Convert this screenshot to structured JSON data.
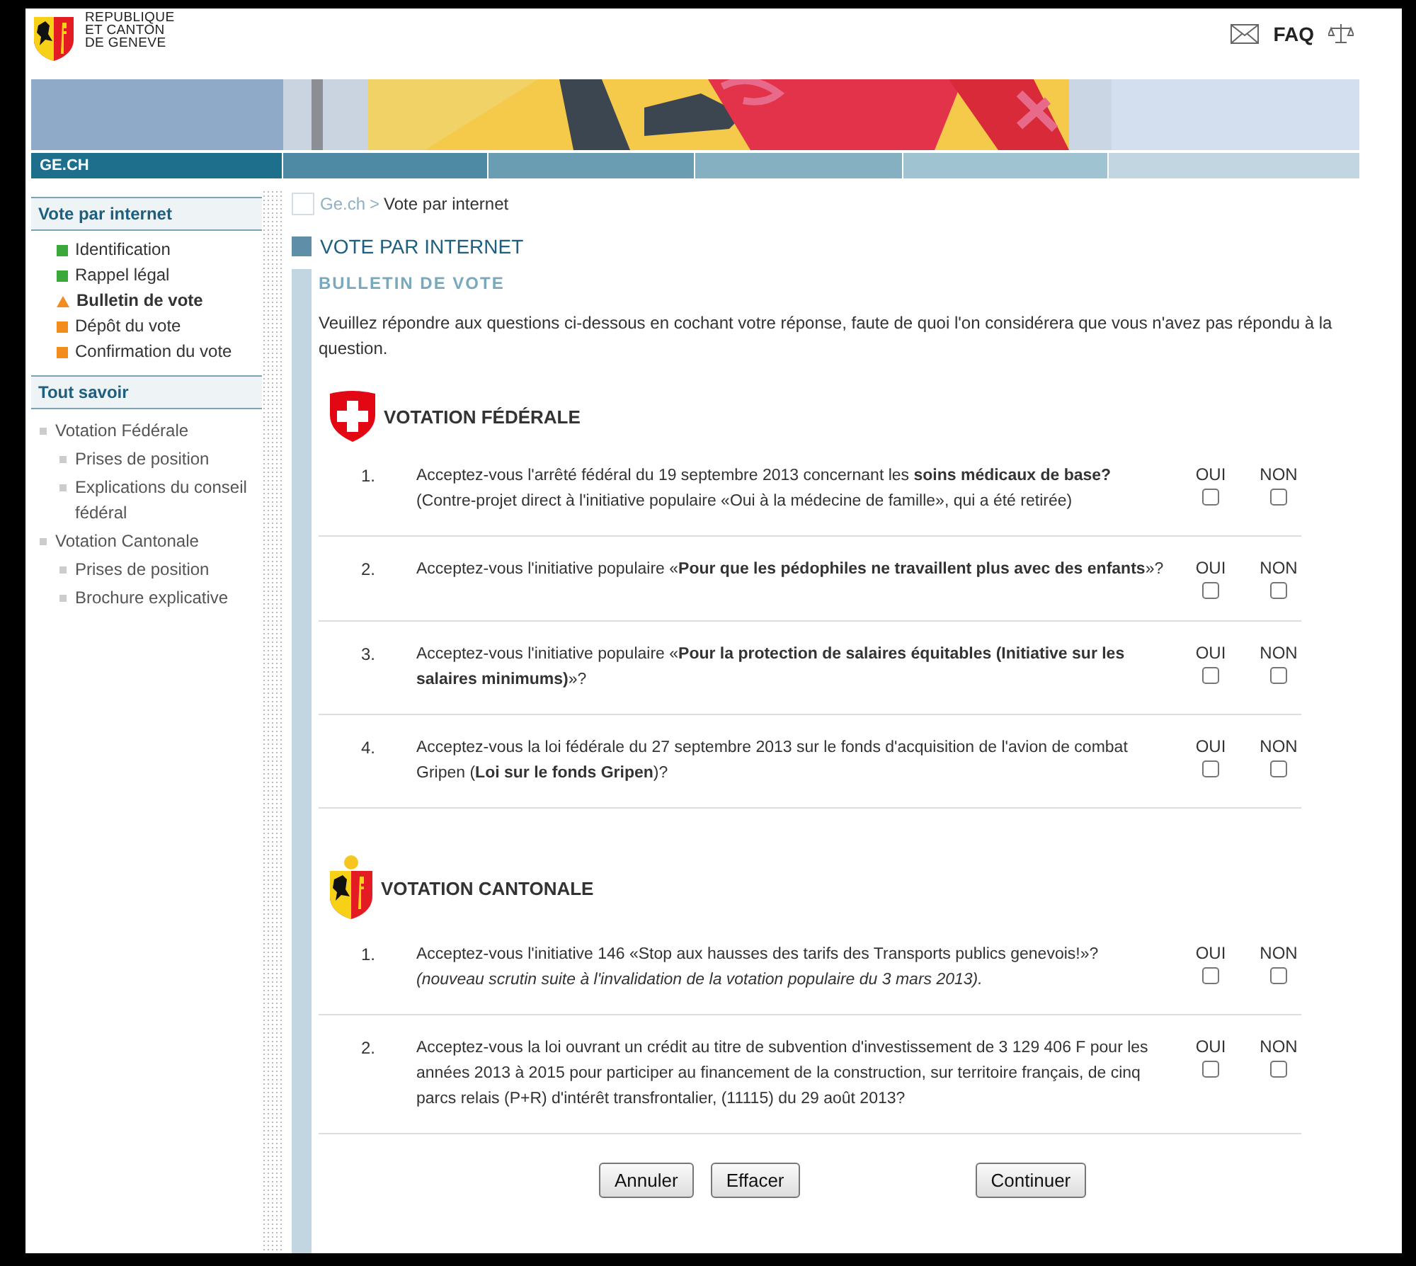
{
  "header": {
    "brand_lines": [
      "REPUBLIQUE",
      "ET CANTON",
      "DE GENEVE"
    ],
    "faq": "FAQ"
  },
  "nav": {
    "label": "GE.CH"
  },
  "sidebar": {
    "sections": [
      {
        "title": "Vote par internet",
        "items": [
          {
            "label": "Identification",
            "color": "#3aa83a",
            "selected": false
          },
          {
            "label": "Rappel légal",
            "color": "#3aa83a",
            "selected": false
          },
          {
            "label": "Bulletin de vote",
            "color": "#f28c1c",
            "selected": true
          },
          {
            "label": "Dépôt du vote",
            "color": "#f28c1c",
            "selected": false
          },
          {
            "label": "Confirmation du vote",
            "color": "#f28c1c",
            "selected": false
          }
        ]
      },
      {
        "title": "Tout savoir",
        "links": [
          {
            "label": "Votation Fédérale",
            "children": [
              {
                "label": "Prises de position"
              },
              {
                "label": "Explications du conseil fédéral"
              }
            ]
          },
          {
            "label": "Votation Cantonale",
            "children": [
              {
                "label": "Prises de position"
              },
              {
                "label": "Brochure explicative"
              }
            ]
          }
        ]
      }
    ]
  },
  "breadcrumb": {
    "home": "Ge.ch",
    "separator": ">",
    "current": "Vote par internet"
  },
  "page_title": "VOTE PAR INTERNET",
  "section_title": "BULLETIN DE VOTE",
  "intro": "Veuillez répondre aux questions ci-dessous en cochant votre réponse, faute de quoi l'on considérera que vous n'avez pas répondu à la question.",
  "ballots": [
    {
      "kind": "federal",
      "title": "VOTATION FÉDÉRALE",
      "questions": [
        {
          "number": "1.",
          "text": "Acceptez-vous l'arrêté fédéral du 19 septembre 2013 concernant les **soins médicaux de base?**",
          "note": {
            "text": "(Contre-projet direct à l'initiative populaire «Oui à la médecine de famille», qui a été retirée)",
            "italic": false
          },
          "options": [
            {
              "label": "OUI",
              "checked": false
            },
            {
              "label": "NON",
              "checked": false
            }
          ]
        },
        {
          "number": "2.",
          "text": "Acceptez-vous l'initiative populaire «**Pour que les pédophiles ne travaillent plus avec des enfants**»?",
          "options": [
            {
              "label": "OUI",
              "checked": false
            },
            {
              "label": "NON",
              "checked": false
            }
          ]
        },
        {
          "number": "3.",
          "text": "Acceptez-vous l'initiative populaire «**Pour la protection de salaires équitables (Initiative sur les salaires minimums)**»?",
          "options": [
            {
              "label": "OUI",
              "checked": false
            },
            {
              "label": "NON",
              "checked": false
            }
          ]
        },
        {
          "number": "4.",
          "text": "Acceptez-vous la loi fédérale du 27 septembre 2013 sur le fonds d'acquisition de l'avion de combat Gripen (**Loi sur le fonds Gripen**)?",
          "options": [
            {
              "label": "OUI",
              "checked": false
            },
            {
              "label": "NON",
              "checked": false
            }
          ]
        }
      ]
    },
    {
      "kind": "cantonal",
      "title": "VOTATION CANTONALE",
      "questions": [
        {
          "number": "1.",
          "text": "Acceptez-vous l'initiative 146 «Stop aux hausses des tarifs des Transports publics genevois!»?",
          "note": {
            "text": "(nouveau scrutin suite à l'invalidation de la votation populaire du 3 mars 2013).",
            "italic": true
          },
          "options": [
            {
              "label": "OUI",
              "checked": false
            },
            {
              "label": "NON",
              "checked": false
            }
          ]
        },
        {
          "number": "2.",
          "text": "Acceptez-vous la loi ouvrant un crédit au titre de subvention d'investissement de 3 129 406 F pour les années 2013 à 2015 pour participer au financement de la construction, sur territoire français, de cinq parcs relais (P+R) d'intérêt transfrontalier, (11115) du 29 août 2013?",
          "options": [
            {
              "label": "OUI",
              "checked": false
            },
            {
              "label": "NON",
              "checked": false
            }
          ]
        }
      ]
    }
  ],
  "buttons": [
    {
      "label": "Annuler",
      "kind": "secondary"
    },
    {
      "label": "Effacer",
      "kind": "secondary"
    },
    {
      "label": "Continuer",
      "kind": "primary"
    }
  ]
}
